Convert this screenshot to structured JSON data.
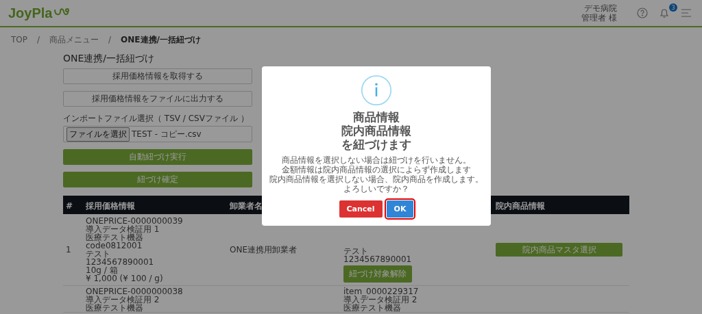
{
  "header": {
    "logo": "JoyPla",
    "hospital": "デモ病院",
    "user": "管理者 様",
    "notification_count": "3"
  },
  "breadcrumb": {
    "separator": "/",
    "items": [
      {
        "label": "TOP",
        "current": false
      },
      {
        "label": "商品メニュー",
        "current": false
      },
      {
        "label": "ONE連携/一括紐づけ",
        "current": true
      }
    ]
  },
  "page_title": "ONE連携/一括紐づけ",
  "actions": [
    "採用価格情報を取得する",
    "採用価格情報をファイルに出力する"
  ],
  "import": {
    "label": "インポートファイル選択（ TSV / CSVファイル ）",
    "choose_button": "ファイルを選択",
    "file_name": "TEST - コピー.csv"
  },
  "submit_actions": [
    "自動紐づけ実行",
    "紐づけ確定"
  ],
  "table": {
    "columns": [
      "#",
      "採用価格情報",
      "卸業者名",
      "院内商品情報"
    ],
    "rows": [
      {
        "number": "1",
        "price_info": [
          "ONEPRICE-0000000039",
          "導入データ検証用 1",
          "医療テスト機器",
          "code0812001",
          "テスト",
          "1234567890001",
          "10g / 箱",
          "¥ 1,000 (¥ 100 / g)"
        ],
        "wholesaler": "ONE連携用卸業者",
        "item_info": [
          "テスト",
          "1234567890001"
        ],
        "unlink_button": "紐づけ対象解除",
        "master_button": "院内商品マスタ選択"
      },
      {
        "price_info": [
          "ONEPRICE-0000000038",
          "導入データ検証用 2",
          "医療テスト機器"
        ],
        "item_info": [
          "item_0000229317",
          "導入データ検証用 2",
          "医療テスト機器"
        ]
      }
    ]
  },
  "dialog": {
    "title_lines": [
      "商品情報",
      "院内商品情報",
      "を紐づけます"
    ],
    "message_lines": [
      "商品情報を選択しない場合は紐づけを行いません。",
      "金額情報は院内商品情報の選択によらず作成します",
      "院内商品情報を選択しない場合、院内商品を作成します。",
      "よろしいですか？"
    ],
    "buttons": [
      {
        "kind": "cancel",
        "label": "Cancel",
        "focused": false
      },
      {
        "kind": "confirm",
        "label": "OK",
        "focused": true
      }
    ]
  }
}
